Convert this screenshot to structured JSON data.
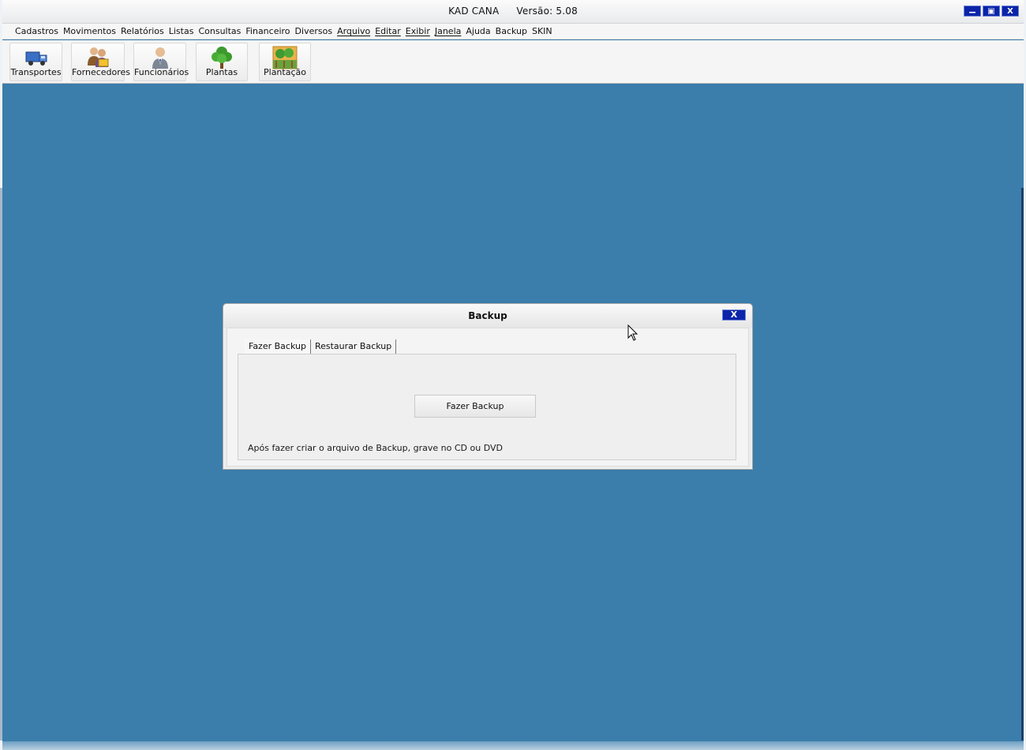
{
  "app": {
    "name": "KAD CANA",
    "version_text": "Versão: 5.08",
    "window_buttons": {
      "minimize": "▁",
      "maximize": "▣",
      "close": "X"
    }
  },
  "menu": {
    "items": [
      "Cadastros",
      "Movimentos",
      "Relatórios",
      "Listas",
      "Consultas",
      "Financeiro",
      "Diversos",
      "Arquivo",
      "Editar",
      "Exibir",
      "Janela",
      "Ajuda",
      "Backup",
      "SKIN"
    ]
  },
  "toolbar": {
    "buttons": [
      {
        "label": "Transportes",
        "icon": "truck-icon"
      },
      {
        "label": "Fornecedores",
        "icon": "suppliers-icon"
      },
      {
        "label": "Funcionários",
        "icon": "employee-icon"
      },
      {
        "label": "Plantas",
        "icon": "tree-icon"
      },
      {
        "label": "Plantação",
        "icon": "plantation-icon"
      }
    ]
  },
  "dialog": {
    "title": "Backup",
    "close_label": "X",
    "tabs": [
      "Fazer Backup",
      "Restaurar Backup"
    ],
    "active_tab": "Fazer Backup",
    "action_button": "Fazer Backup",
    "hint": "Após fazer criar o arquivo de Backup, grave no CD ou DVD"
  },
  "colors": {
    "workspace": "#3b7dab",
    "window_button": "#0b24a8",
    "titlebar": "#f4f4f4"
  }
}
